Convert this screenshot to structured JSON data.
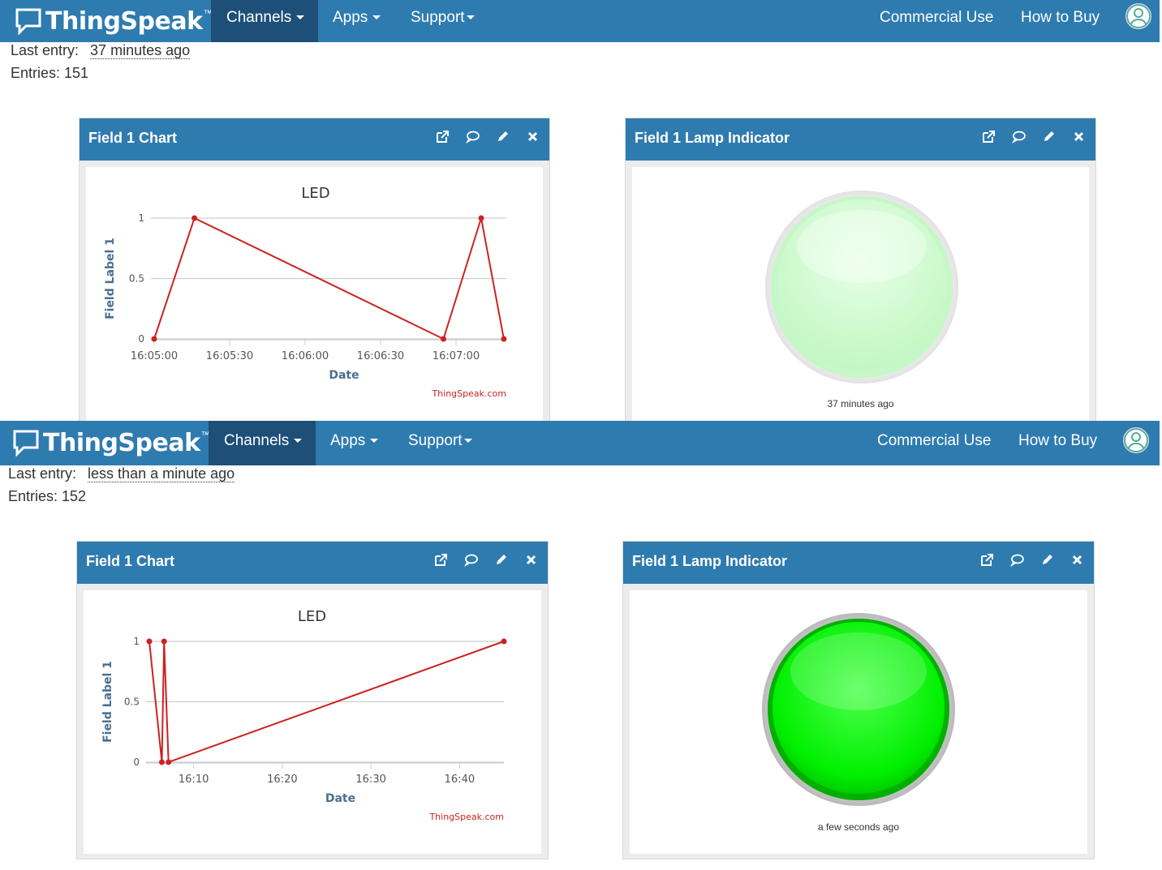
{
  "nav": {
    "brand": "ThingSpeak",
    "trademark": "™",
    "channels_label": "Channels",
    "apps_label": "Apps",
    "support_label": "Support",
    "commercial_label": "Commercial Use",
    "howtobuy_label": "How to Buy",
    "colors": {
      "bar": "#2e7bb0",
      "active": "#1d4f78"
    }
  },
  "top": {
    "last_entry_label": "Last entry:",
    "last_entry_value": "37 minutes ago",
    "entries_text": "Entries: 151",
    "chart_widget_title": "Field 1 Chart",
    "lamp_widget_title": "Field 1 Lamp Indicator",
    "lamp_state": "off",
    "lamp_caption": "37 minutes ago"
  },
  "bottom": {
    "last_entry_label": "Last entry:",
    "last_entry_value": "less than a minute ago",
    "entries_text": "Entries: 152",
    "chart_widget_title": "Field 1 Chart",
    "lamp_widget_title": "Field 1 Lamp Indicator",
    "lamp_state": "on",
    "lamp_caption": "a few seconds ago"
  },
  "icons": [
    "external-link-icon",
    "comment-icon",
    "pencil-icon",
    "close-icon",
    "chat-logo-icon",
    "user-avatar-icon"
  ],
  "chart_data": [
    {
      "type": "line",
      "title": "LED",
      "xlabel": "Date",
      "ylabel": "Field Label 1",
      "credit": "ThingSpeak.com",
      "x": [
        "16:05:00",
        "16:05:16",
        "16:06:55",
        "16:07:10",
        "16:07:19"
      ],
      "series": [
        {
          "values": [
            0,
            1,
            0,
            1,
            0
          ]
        }
      ],
      "xticks": [
        "16:05:00",
        "16:05:30",
        "16:06:00",
        "16:06:30",
        "16:07:00"
      ],
      "yticks": [
        "0",
        "0.5",
        "1"
      ],
      "ylim": [
        0,
        1
      ],
      "color": "#cc2222"
    },
    {
      "type": "line",
      "title": "LED",
      "xlabel": "Date",
      "ylabel": "Field Label 1",
      "credit": "ThingSpeak.com",
      "x": [
        "16:05",
        "16:06:25",
        "16:06:40",
        "16:07:10",
        "16:45"
      ],
      "series": [
        {
          "values": [
            1,
            0,
            1,
            0,
            1
          ]
        }
      ],
      "xticks": [
        "16:10",
        "16:20",
        "16:30",
        "16:40"
      ],
      "yticks": [
        "0",
        "0.5",
        "1"
      ],
      "ylim": [
        0,
        1
      ],
      "color": "#cc2222"
    }
  ]
}
